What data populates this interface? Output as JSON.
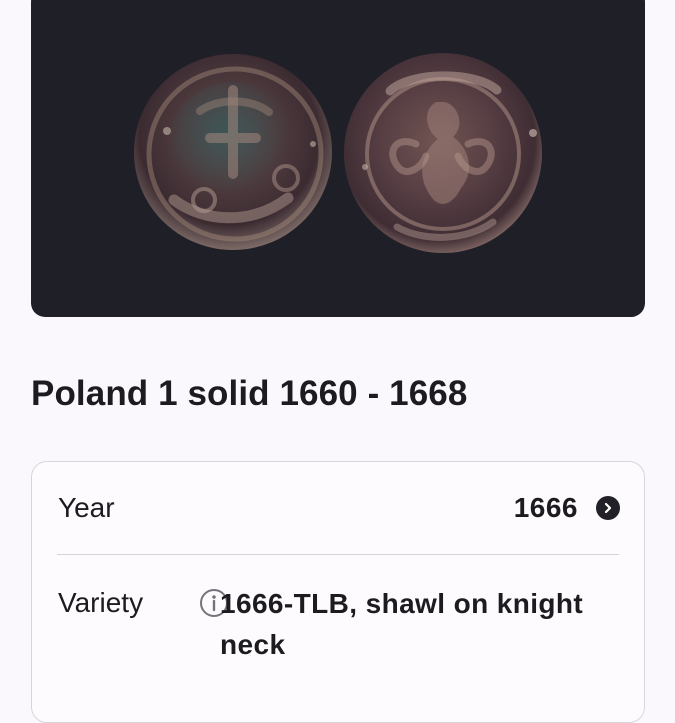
{
  "coin": {
    "title": "Poland 1 solid 1660 - 1668"
  },
  "details": {
    "year": {
      "label": "Year",
      "value": "1666"
    },
    "variety": {
      "label": "Variety",
      "value": "1666-TLB, shawl on knight neck"
    }
  },
  "icons": {
    "year_action": "chevron-right-icon",
    "variety_info": "info-icon"
  },
  "colors": {
    "image_background": "#1f2027",
    "page_background": "#fbf8fd",
    "text": "#1c1b20",
    "card_border": "#d8d4dc",
    "icon_dark": "#222127"
  }
}
